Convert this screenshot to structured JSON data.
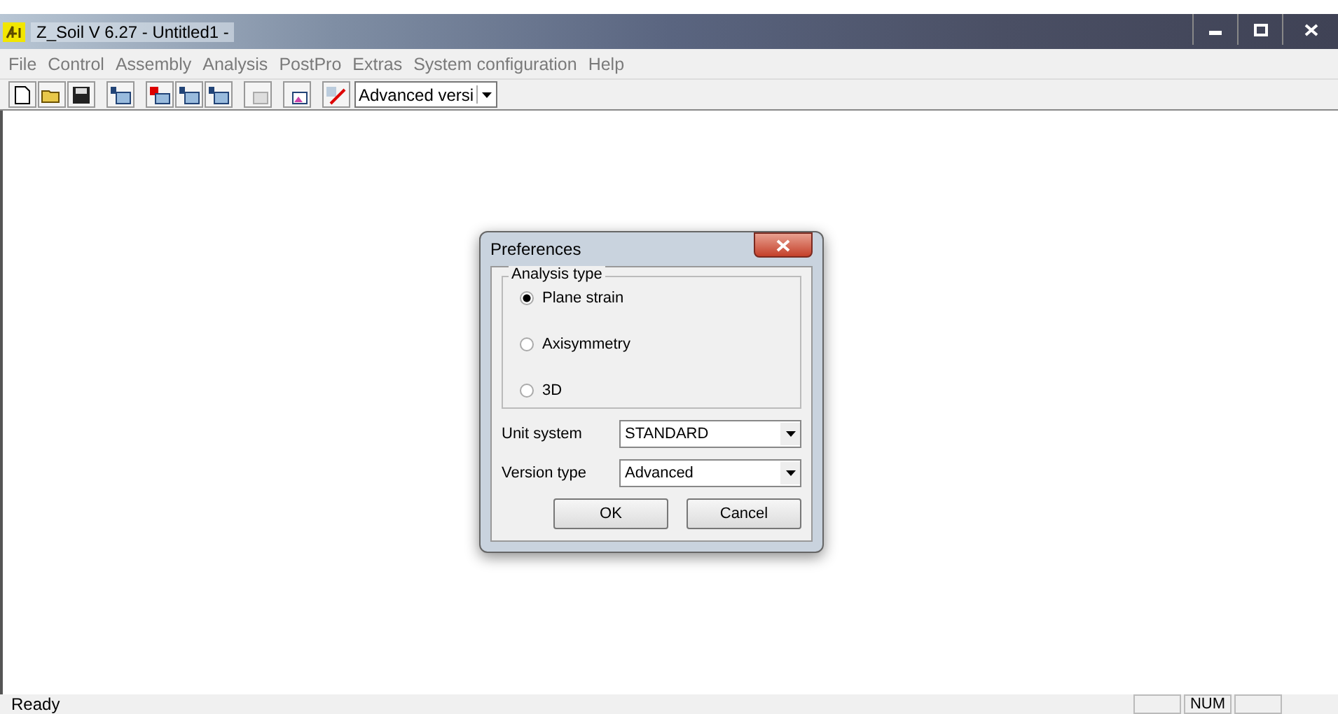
{
  "window": {
    "title": "Z_Soil V 6.27 - Untitled1 -"
  },
  "menu": [
    "File",
    "Control",
    "Assembly",
    "Analysis",
    "PostPro",
    "Extras",
    "System configuration",
    "Help"
  ],
  "toolbar": {
    "version_combo": "Advanced versi"
  },
  "dialog": {
    "title": "Preferences",
    "group_label": "Analysis type",
    "analysis_types": [
      {
        "label": "Plane strain",
        "selected": true
      },
      {
        "label": "Axisymmetry",
        "selected": false
      },
      {
        "label": "3D",
        "selected": false
      }
    ],
    "fields": [
      {
        "label": "Unit system",
        "value": "STANDARD"
      },
      {
        "label": "Version type",
        "value": "Advanced"
      }
    ],
    "buttons": [
      "OK",
      "Cancel"
    ]
  },
  "status_bar": {
    "text": "Ready",
    "indicator": "NUM"
  }
}
